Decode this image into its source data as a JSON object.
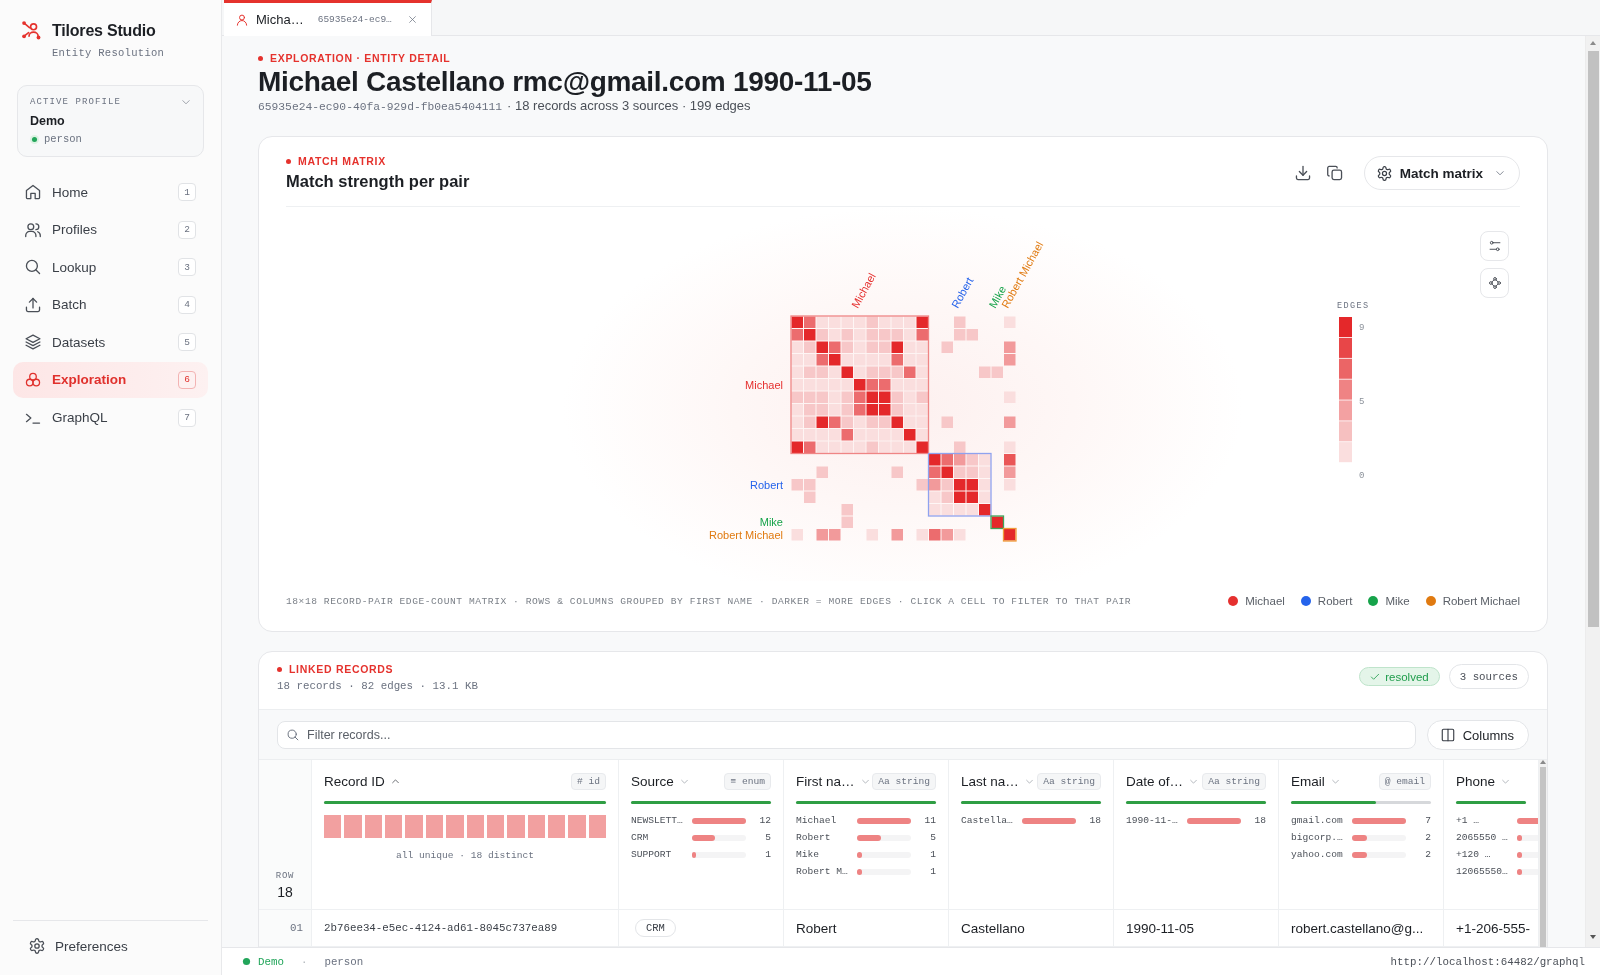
{
  "sidebar": {
    "brand": {
      "name": "Tilores Studio",
      "subtitle": "Entity Resolution"
    },
    "profile": {
      "label": "ACTIVE PROFILE",
      "name": "Demo",
      "type": "person",
      "connected": true
    },
    "items": [
      {
        "label": "Home",
        "shortcut": "1",
        "selected": false
      },
      {
        "label": "Profiles",
        "shortcut": "2",
        "selected": false
      },
      {
        "label": "Lookup",
        "shortcut": "3",
        "selected": false
      },
      {
        "label": "Batch",
        "shortcut": "4",
        "selected": false
      },
      {
        "label": "Datasets",
        "shortcut": "5",
        "selected": false
      },
      {
        "label": "Exploration",
        "shortcut": "6",
        "selected": true
      },
      {
        "label": "GraphQL",
        "shortcut": "7",
        "selected": false
      }
    ],
    "footer": {
      "label": "Preferences"
    }
  },
  "tabs": [
    {
      "title": "Micha…",
      "subtitle": "65935e24-ec9…",
      "selected": true
    }
  ],
  "page": {
    "eyebrow": "EXPLORATION · ENTITY DETAIL",
    "title": "Michael Castellano rmc@gmail.com 1990-11-05",
    "entity_id": "65935e24-ec90-40fa-929d-fb0ea5404111",
    "summary": "· 18 records across 3 sources · 199 edges"
  },
  "match_matrix": {
    "eyebrow": "MATCH MATRIX",
    "title": "Match strength per pair",
    "view_button": "Match matrix",
    "column_labels": [
      "Michael",
      "Robert",
      "Mike",
      "Robert Michael"
    ],
    "row_labels": [
      "Michael",
      "Robert",
      "Mike",
      "Robert Michael"
    ],
    "color_scale": {
      "title": "EDGES",
      "ticks": [
        "9",
        "5",
        "0"
      ]
    },
    "caption": "18×18 RECORD-PAIR EDGE-COUNT MATRIX · ROWS & COLUMNS GROUPED BY FIRST NAME · DARKER = MORE EDGES · CLICK A CELL TO FILTER TO THAT PAIR",
    "legend": [
      {
        "label": "Michael",
        "color": "#e5302f"
      },
      {
        "label": "Robert",
        "color": "#2563eb"
      },
      {
        "label": "Mike",
        "color": "#16a34a"
      },
      {
        "label": "Robert Michael",
        "color": "#e07a10"
      }
    ]
  },
  "linked_records": {
    "eyebrow": "LINKED RECORDS",
    "summary": "18 records · 82 edges · 13.1 KB",
    "badges": [
      {
        "label": "resolved",
        "kind": "status"
      },
      {
        "label": "3 sources",
        "kind": "count"
      }
    ],
    "filter": {
      "placeholder": "Filter records..."
    },
    "columns_button": "Columns",
    "table": {
      "row_header": {
        "label": "ROW",
        "count": "18"
      },
      "columns": [
        {
          "name": "Record ID",
          "sorted": true,
          "type": "# id",
          "kind": "id",
          "level": 1,
          "profile": {
            "kind": "unique",
            "note": "all unique · 18 distinct"
          }
        },
        {
          "name": "Source",
          "sorted": false,
          "type": "≡ enum",
          "kind": "enum",
          "level": 1,
          "profile": {
            "kind": "bars",
            "stats": [
              {
                "label": "NEWSLETT…",
                "count": "12",
                "level": 1
              },
              {
                "label": "CRM",
                "count": "5",
                "level": 0.42
              },
              {
                "label": "SUPPORT",
                "count": "1",
                "level": 0.08
              }
            ]
          }
        },
        {
          "name": "First na…",
          "sorted": false,
          "type": "Aa string",
          "kind": "text",
          "level": 1,
          "profile": {
            "kind": "bars",
            "stats": [
              {
                "label": "Michael",
                "count": "11",
                "level": 1
              },
              {
                "label": "Robert",
                "count": "5",
                "level": 0.45
              },
              {
                "label": "Mike",
                "count": "1",
                "level": 0.09
              },
              {
                "label": "Robert M…",
                "count": "1",
                "level": 0.09
              }
            ]
          }
        },
        {
          "name": "Last na…",
          "sorted": false,
          "type": "Aa string",
          "kind": "text",
          "level": 1,
          "profile": {
            "kind": "bars",
            "stats": [
              {
                "label": "Castella…",
                "count": "18",
                "level": 1
              }
            ]
          }
        },
        {
          "name": "Date of…",
          "sorted": false,
          "type": "Aa string",
          "kind": "text",
          "level": 1,
          "profile": {
            "kind": "bars",
            "stats": [
              {
                "label": "1990-11-…",
                "count": "18",
                "level": 1
              }
            ]
          }
        },
        {
          "name": "Email",
          "sorted": false,
          "type": "@ email",
          "kind": "text",
          "level": 0.61,
          "profile": {
            "kind": "bars",
            "stats": [
              {
                "label": "gmail.com",
                "count": "7",
                "level": 1
              },
              {
                "label": "bigcorp.…",
                "count": "2",
                "level": 0.28
              },
              {
                "label": "yahoo.com",
                "count": "2",
                "level": 0.28
              }
            ]
          }
        },
        {
          "name": "Phone",
          "sorted": false,
          "kind": "text",
          "level": 1,
          "profile": {
            "kind": "bars",
            "stats": [
              {
                "label": "+1 …",
                "level": 1
              },
              {
                "label": "2065550 …",
                "level": 0.1
              },
              {
                "label": "+120 …",
                "level": 0.1
              },
              {
                "label": "12065550…",
                "level": 0.1
              }
            ]
          }
        }
      ],
      "rows": [
        {
          "number": "01",
          "cells": [
            "2b76ee34-e5ec-4124-ad61-8045c737ea89",
            "CRM",
            "Robert",
            "Castellano",
            "1990-11-05",
            "robert.castellano@g...",
            "+1-206-555-"
          ]
        }
      ]
    }
  },
  "status_bar": {
    "profile": "Demo",
    "connected": true,
    "separator": "·",
    "type": "person",
    "endpoint": "http://localhost:64482/graphql"
  }
}
